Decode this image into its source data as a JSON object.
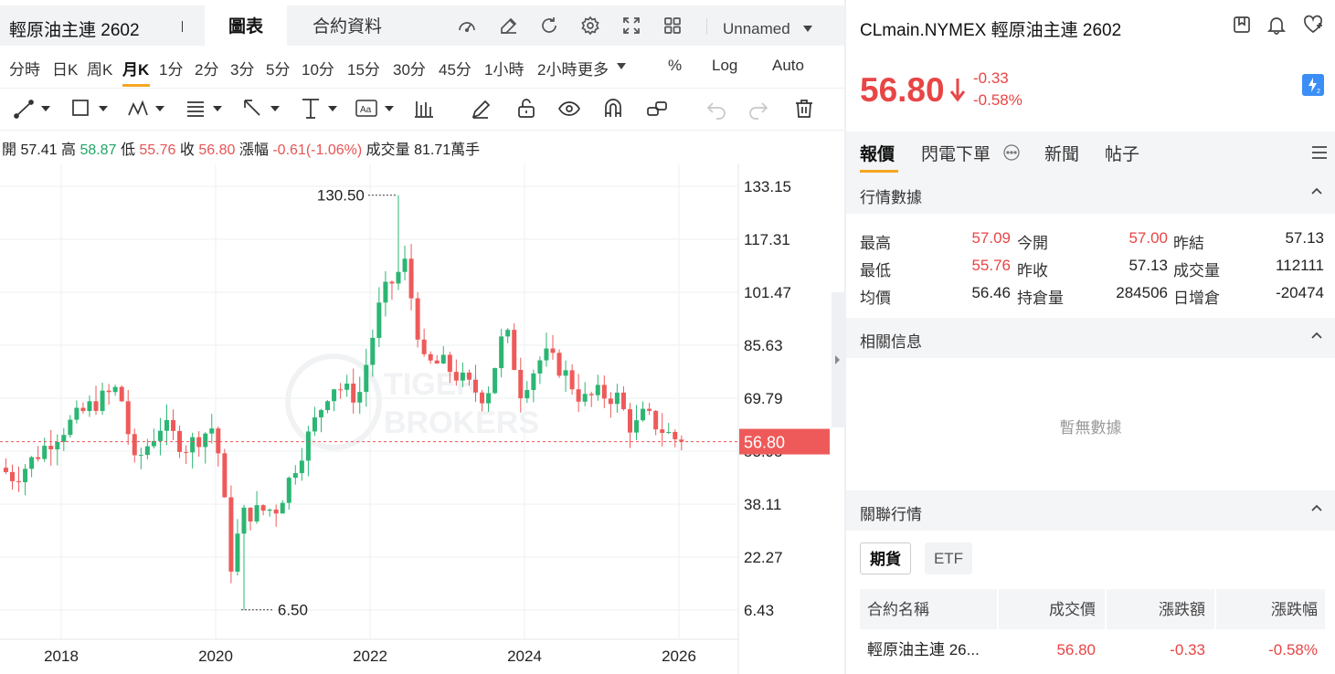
{
  "header": {
    "symbol_title": "輕原油主連 2602",
    "tabs": [
      {
        "label": "圖表",
        "active": true
      },
      {
        "label": "合約資料",
        "active": false
      }
    ],
    "layout_name": "Unnamed"
  },
  "periods": {
    "items": [
      "分時",
      "日K",
      "周K",
      "月K",
      "1分",
      "2分",
      "3分",
      "5分",
      "10分",
      "15分",
      "30分",
      "45分",
      "1小時",
      "2小時"
    ],
    "more_label": "更多",
    "active": "月K",
    "scale_options": [
      "%",
      "Log",
      "Auto"
    ]
  },
  "ohlc": {
    "open_label": "開",
    "open": "57.41",
    "high_label": "高",
    "high": "58.87",
    "low_label": "低",
    "low": "55.76",
    "close_label": "收",
    "close": "56.80",
    "change_label": "漲幅",
    "change": "-0.61(-1.06%)",
    "volume_label": "成交量",
    "volume": "81.71萬手"
  },
  "chart_data": {
    "type": "candlestick",
    "title": "",
    "y_ticks": [
      133.15,
      117.31,
      101.47,
      85.63,
      69.79,
      38.11,
      22.27,
      6.43
    ],
    "x_ticks": [
      "2018",
      "2020",
      "2022",
      "2024",
      "2026"
    ],
    "ylim": [
      6.43,
      133.15
    ],
    "current_price": 56.8,
    "current_price_label": "56.80",
    "max_marker": {
      "value": 130.5,
      "label": "130.50"
    },
    "min_marker": {
      "value": 6.5,
      "label": "6.50"
    },
    "colors": {
      "up": "#2bb673",
      "down": "#ee5a5a"
    },
    "watermark": [
      "TIGER",
      "BROKERS"
    ]
  },
  "right": {
    "title": "CLmain.NYMEX 輕原油主連 2602",
    "price": "56.80",
    "change": "-0.33",
    "change_pct": "-0.58%",
    "tabs": [
      "報價",
      "閃電下單",
      "新聞",
      "帖子"
    ],
    "quote_section": "行情數據",
    "quote": [
      {
        "label": "最高",
        "value": "57.09",
        "red": true
      },
      {
        "label": "今開",
        "value": "57.00",
        "red": true
      },
      {
        "label": "昨結",
        "value": "57.13",
        "red": false
      },
      {
        "label": "最低",
        "value": "55.76",
        "red": true
      },
      {
        "label": "昨收",
        "value": "57.13",
        "red": false
      },
      {
        "label": "成交量",
        "value": "112111",
        "red": false
      },
      {
        "label": "均價",
        "value": "56.46",
        "red": false
      },
      {
        "label": "持倉量",
        "value": "284506",
        "red": false
      },
      {
        "label": "日增倉",
        "value": "-20474",
        "red": false
      }
    ],
    "related_section": "相關信息",
    "no_data": "暫無數據",
    "linked_section": "關聯行情",
    "linked_tabs": [
      "期貨",
      "ETF"
    ],
    "table_headers": [
      "合約名稱",
      "成交價",
      "漲跌額",
      "漲跌幅"
    ],
    "table_rows": [
      {
        "name": "輕原油主連 26...",
        "price": "56.80",
        "change": "-0.33",
        "pct": "-0.58%"
      }
    ]
  }
}
